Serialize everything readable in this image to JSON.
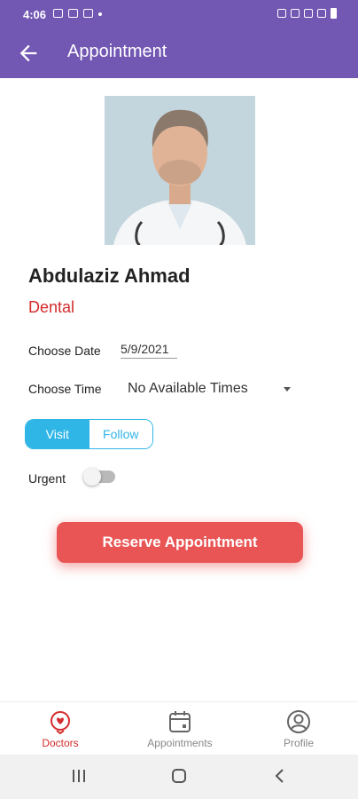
{
  "status_bar": {
    "time": "4:06",
    "icons": [
      "image-icon",
      "message-icon",
      "chat-icon",
      "dot-icon",
      "key-icon",
      "sim-icon",
      "alarm-icon",
      "signal-icon",
      "battery-icon"
    ]
  },
  "header": {
    "title": "Appointment",
    "back_icon": "arrow-left-icon"
  },
  "doctor": {
    "name": "Abdulaziz Ahmad",
    "specialty": "Dental"
  },
  "form": {
    "date_label": "Choose Date",
    "date_value": "5/9/2021",
    "time_label": "Choose Time",
    "time_value": "No Available Times",
    "type_options": [
      "Visit",
      "Follow"
    ],
    "selected_type": "Visit",
    "urgent_label": "Urgent",
    "urgent_on": false,
    "submit_label": "Reserve Appointment"
  },
  "bottom_nav": {
    "items": [
      {
        "label": "Doctors",
        "icon": "heart-pin-icon",
        "active": true
      },
      {
        "label": "Appointments",
        "icon": "calendar-icon",
        "active": false
      },
      {
        "label": "Profile",
        "icon": "user-circle-icon",
        "active": false
      }
    ]
  },
  "colors": {
    "app_bar": "#7257b3",
    "accent_red": "#d42b2b",
    "button_red": "#e95555",
    "segment_blue": "#2fb5e6"
  }
}
